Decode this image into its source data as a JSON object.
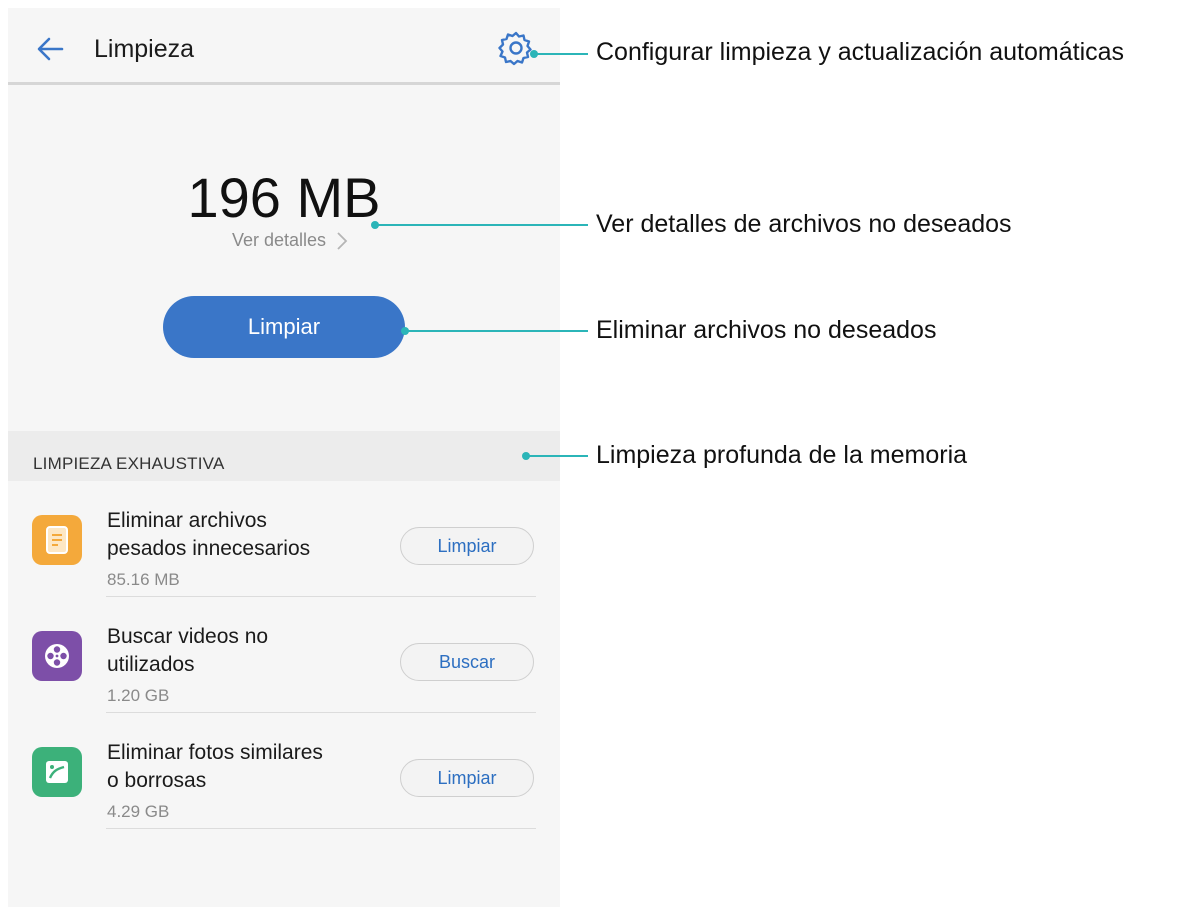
{
  "header": {
    "title": "Limpieza"
  },
  "summary": {
    "size": "196 MB",
    "details_label": "Ver detalles"
  },
  "primary_action": {
    "label": "Limpiar"
  },
  "section": {
    "title": "LIMPIEZA EXHAUSTIVA"
  },
  "items": [
    {
      "title_line1": "Eliminar archivos",
      "title_line2": "pesados innecesarios",
      "size": "85.16 MB",
      "action": "Limpiar",
      "icon": "document-icon",
      "color": "#f4a93b"
    },
    {
      "title_line1": "Buscar videos no",
      "title_line2": "utilizados",
      "size": "1.20 GB",
      "action": "Buscar",
      "icon": "film-reel-icon",
      "color": "#7d4fa8"
    },
    {
      "title_line1": "Eliminar fotos similares",
      "title_line2": "o borrosas",
      "size": "4.29 GB",
      "action": "Limpiar",
      "icon": "image-icon",
      "color": "#3cb17a"
    }
  ],
  "callouts": [
    "Configurar limpieza y actualización automáticas",
    "Ver detalles de archivos no deseados",
    "Eliminar archivos no deseados",
    "Limpieza profunda de la memoria"
  ],
  "colors": {
    "accent": "#3a76c8",
    "callout_line": "#2bb5b8"
  }
}
